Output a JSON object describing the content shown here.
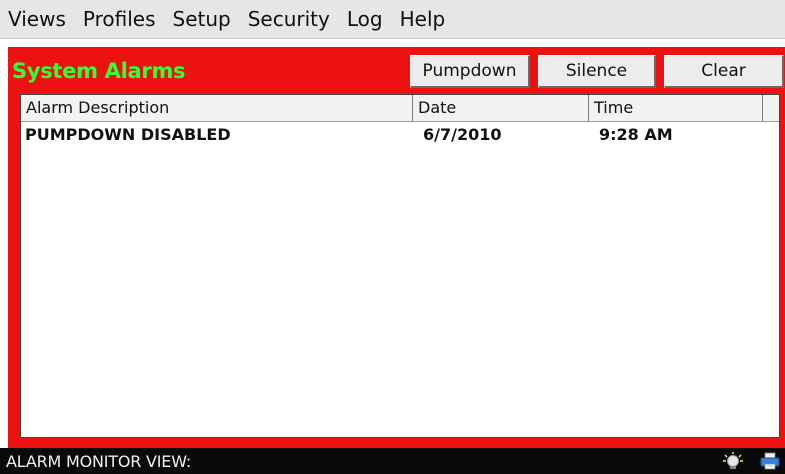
{
  "menu": {
    "items": [
      {
        "label": "Views"
      },
      {
        "label": "Profiles"
      },
      {
        "label": "Setup"
      },
      {
        "label": "Security"
      },
      {
        "label": "Log"
      },
      {
        "label": "Help"
      }
    ]
  },
  "panel": {
    "title": "System Alarms",
    "buttons": {
      "pumpdown": "Pumpdown",
      "silence": "Silence",
      "clear": "Clear"
    },
    "colors": {
      "background": "#ee1111",
      "title": "#33ff33"
    }
  },
  "table": {
    "columns": [
      "Alarm Description",
      "Date",
      "Time"
    ],
    "rows": [
      {
        "description": "PUMPDOWN DISABLED",
        "date": "6/7/2010",
        "time": "9:28 AM"
      }
    ]
  },
  "status": {
    "text": "ALARM MONITOR VIEW:",
    "icons": [
      "bulb-icon",
      "printer-icon"
    ]
  }
}
